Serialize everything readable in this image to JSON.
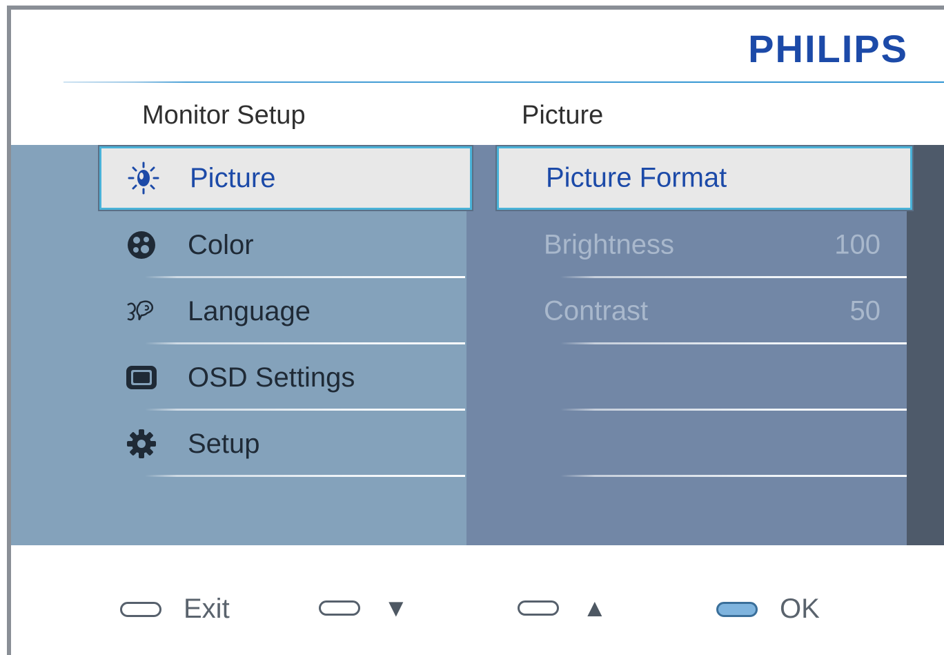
{
  "brand": {
    "logo": "PHILIPS",
    "logo_color": "#1c4aa8"
  },
  "columns": {
    "left_title": "Monitor Setup",
    "right_title": "Picture"
  },
  "menu": {
    "items": [
      {
        "label": "Picture",
        "icon": "sun-icon",
        "selected": true
      },
      {
        "label": "Color",
        "icon": "palette-icon",
        "selected": false
      },
      {
        "label": "Language",
        "icon": "speech-icon",
        "selected": false
      },
      {
        "label": "OSD Settings",
        "icon": "display-icon",
        "selected": false
      },
      {
        "label": "Setup",
        "icon": "gear-icon",
        "selected": false
      }
    ]
  },
  "submenu": {
    "items": [
      {
        "label": "Picture Format",
        "value": "",
        "selected": true
      },
      {
        "label": "Brightness",
        "value": "100",
        "selected": false
      },
      {
        "label": "Contrast",
        "value": "50",
        "selected": false
      }
    ]
  },
  "footer": {
    "buttons": [
      {
        "label": "Exit",
        "icon": "pill-button-icon"
      },
      {
        "label": "▼",
        "icon": "down-triangle-icon"
      },
      {
        "label": "▲",
        "icon": "up-triangle-icon"
      },
      {
        "label": "OK",
        "icon": "pill-button-ok-icon"
      }
    ]
  },
  "colors": {
    "selection_border": "#4ab2d8",
    "left_panel": "#84a2bb",
    "right_panel": "#7287a6",
    "edge_panel": "#4e5a6a"
  }
}
